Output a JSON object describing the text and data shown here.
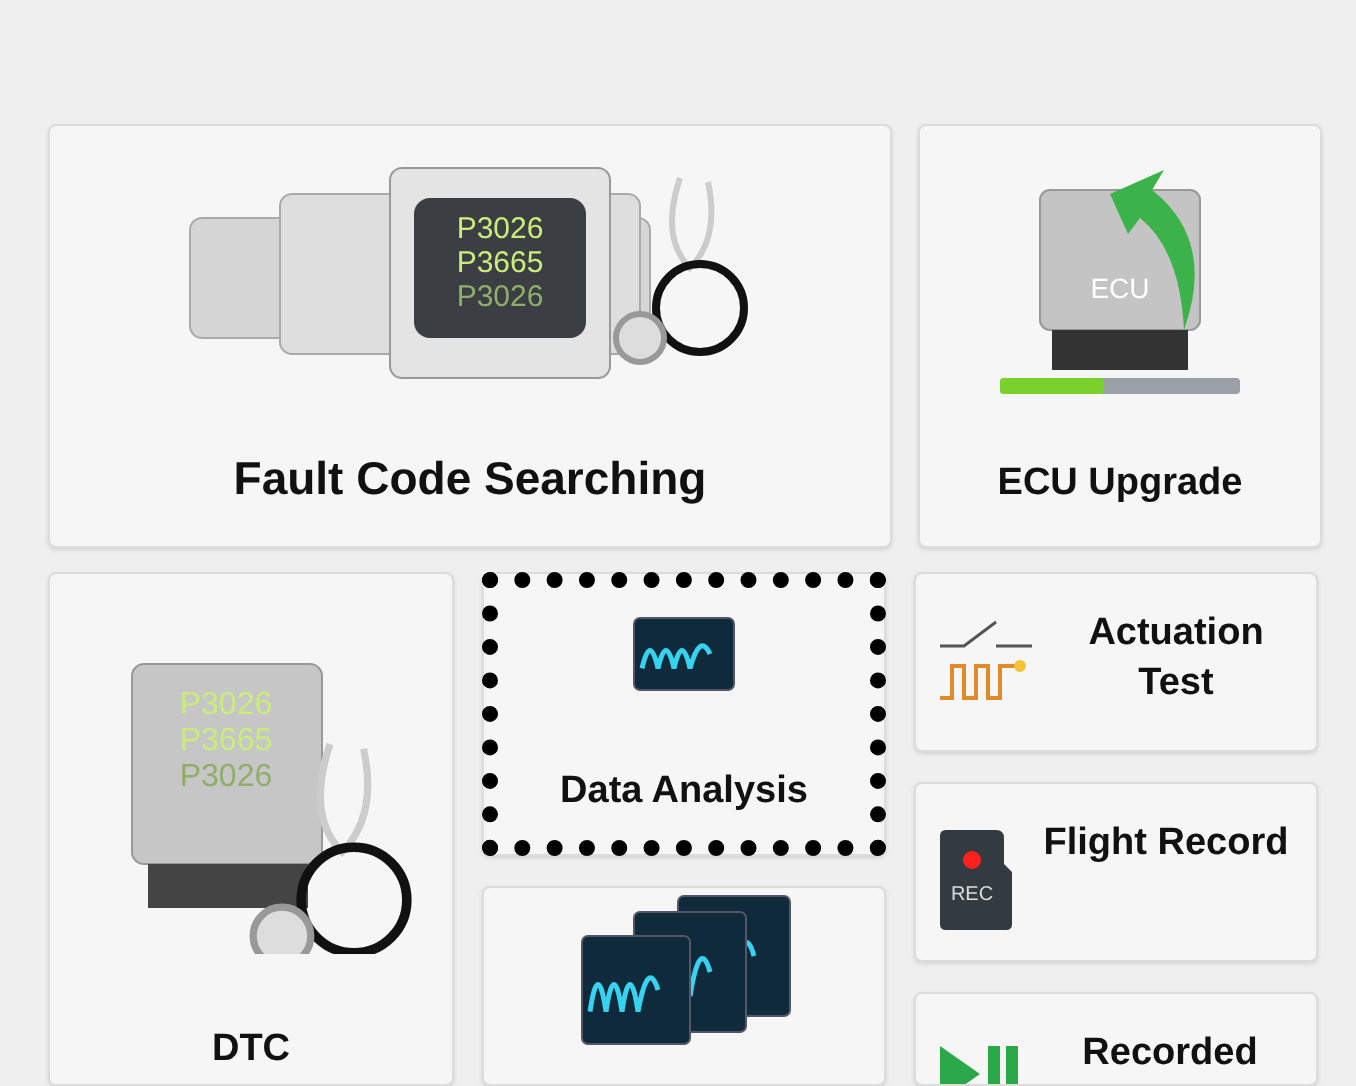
{
  "top": [
    {
      "kind": "wide",
      "label": "Fault Code Searching",
      "codes": [
        "P3026",
        "P3665",
        "P3026"
      ],
      "focused": false
    },
    {
      "kind": "stacked",
      "label": "ECU Upgrade",
      "badge": "ECU",
      "focused": false
    }
  ],
  "columns": [
    [
      {
        "kind": "tall",
        "label": "DTC",
        "codes": [
          "P3026",
          "P3665",
          "P3026"
        ],
        "focused": false
      }
    ],
    [
      {
        "kind": "stacked",
        "label": "Data Analysis",
        "focused": true
      },
      {
        "kind": "stacked",
        "focused": false
      }
    ],
    [
      {
        "kind": "row",
        "label": "Actuation Test",
        "focused": false
      },
      {
        "kind": "row",
        "label": "Flight Record",
        "badge": "REC",
        "focused": false
      },
      {
        "kind": "row",
        "label": "Recorded",
        "focused": false
      }
    ]
  ]
}
